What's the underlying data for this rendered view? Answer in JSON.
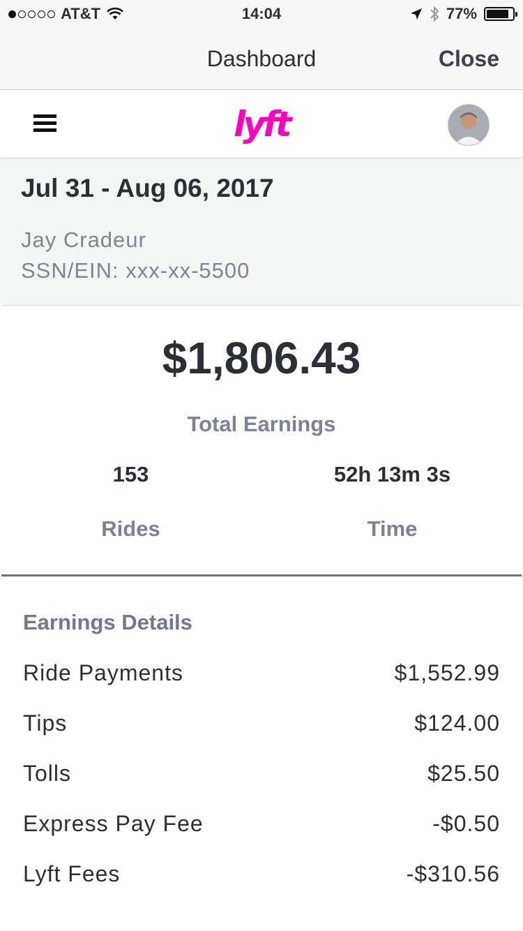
{
  "status_bar": {
    "carrier": "AT&T",
    "time": "14:04",
    "battery": "77%",
    "battery_level": 0.77,
    "signal_bars_filled": 1,
    "signal_bars_total": 5
  },
  "nav": {
    "title": "Dashboard",
    "close_label": "Close"
  },
  "header": {
    "logo_text": "lyft",
    "menu_icon": "hamburger-menu-icon",
    "avatar_icon": "user-avatar"
  },
  "period": {
    "date_range": "Jul 31 - Aug 06, 2017",
    "driver_name": "Jay Cradeur",
    "ssn": "SSN/EIN: xxx-xx-5500"
  },
  "summary": {
    "total_earnings": "$1,806.43",
    "total_label": "Total Earnings",
    "rides_value": "153",
    "rides_label": "Rides",
    "time_value": "52h 13m 3s",
    "time_label": "Time"
  },
  "details": {
    "title": "Earnings Details",
    "rows": [
      {
        "label": "Ride Payments",
        "value": "$1,552.99"
      },
      {
        "label": "Tips",
        "value": "$124.00"
      },
      {
        "label": "Tolls",
        "value": "$25.50"
      },
      {
        "label": "Express Pay Fee",
        "value": "-$0.50"
      },
      {
        "label": "Lyft Fees",
        "value": "-$310.56"
      }
    ]
  },
  "colors": {
    "brand": "#ff00bf",
    "text_dark": "#2c2f36",
    "text_muted": "#7a8398",
    "section_bg": "#f4f5f5"
  }
}
